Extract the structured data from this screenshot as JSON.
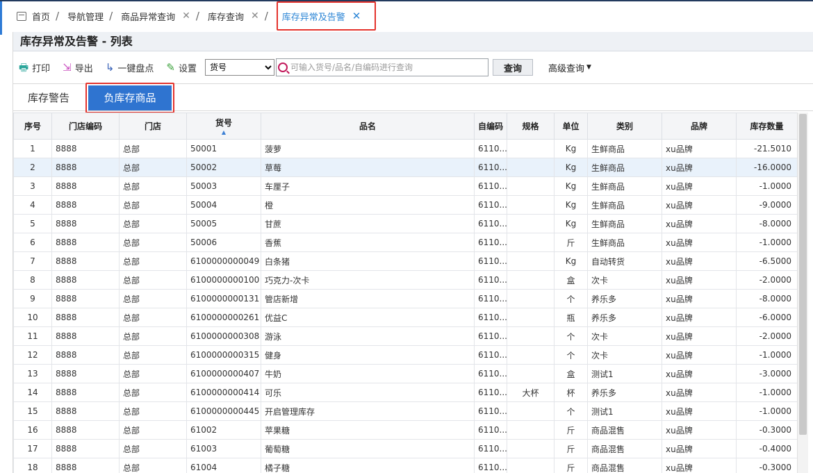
{
  "breadcrumbs": [
    {
      "label": "首页",
      "closable": false,
      "sep": "/"
    },
    {
      "label": "导航管理",
      "closable": false,
      "sep": "/"
    },
    {
      "label": "商品异常查询",
      "closable": true,
      "sep": "/"
    },
    {
      "label": "库存查询",
      "closable": true,
      "sep": "/"
    },
    {
      "label": "库存异常及告警",
      "closable": true,
      "active": true
    }
  ],
  "page_title": "库存异常及告警 - 列表",
  "toolbar": {
    "print_label": "打印",
    "export_label": "导出",
    "stocktake_label": "一键盘点",
    "settings_label": "设置",
    "type_select_value": "货号",
    "search_placeholder": "可输入货号/品名/自编码进行查询",
    "query_label": "查询",
    "advanced_query_label": "高级查询"
  },
  "subtabs": {
    "warning_label": "库存警告",
    "negative_label": "负库存商品"
  },
  "colors": {
    "accent_blue": "#2f74d0",
    "highlight_red": "#e4322c",
    "active_crumb": "#2d86d6"
  },
  "table": {
    "headers": [
      "序号",
      "门店编码",
      "门店",
      "货号",
      "品名",
      "自编码",
      "规格",
      "单位",
      "类别",
      "品牌",
      "库存数量"
    ],
    "rows": [
      [
        "1",
        "8888",
        "总部",
        "50001",
        "菠萝",
        "6110...",
        "",
        "Kg",
        "生鲜商品",
        "xu品牌",
        "-21.5010"
      ],
      [
        "2",
        "8888",
        "总部",
        "50002",
        "草莓",
        "6110...",
        "",
        "Kg",
        "生鲜商品",
        "xu品牌",
        "-16.0000"
      ],
      [
        "3",
        "8888",
        "总部",
        "50003",
        "车厘子",
        "6110...",
        "",
        "Kg",
        "生鲜商品",
        "xu品牌",
        "-1.0000"
      ],
      [
        "4",
        "8888",
        "总部",
        "50004",
        "橙",
        "6110...",
        "",
        "Kg",
        "生鲜商品",
        "xu品牌",
        "-9.0000"
      ],
      [
        "5",
        "8888",
        "总部",
        "50005",
        "甘蔗",
        "6110...",
        "",
        "Kg",
        "生鲜商品",
        "xu品牌",
        "-8.0000"
      ],
      [
        "6",
        "8888",
        "总部",
        "50006",
        "香蕉",
        "6110...",
        "",
        "斤",
        "生鲜商品",
        "xu品牌",
        "-1.0000"
      ],
      [
        "7",
        "8888",
        "总部",
        "6100000000049",
        "白条猪",
        "6110...",
        "",
        "Kg",
        "自动转货",
        "xu品牌",
        "-6.5000"
      ],
      [
        "8",
        "8888",
        "总部",
        "6100000000100",
        "巧克力-次卡",
        "6110...",
        "",
        "盒",
        "次卡",
        "xu品牌",
        "-2.0000"
      ],
      [
        "9",
        "8888",
        "总部",
        "6100000000131",
        "管店新增",
        "6110...",
        "",
        "个",
        "养乐多",
        "xu品牌",
        "-8.0000"
      ],
      [
        "10",
        "8888",
        "总部",
        "6100000000261",
        "优益C",
        "6110...",
        "",
        "瓶",
        "养乐多",
        "xu品牌",
        "-6.0000"
      ],
      [
        "11",
        "8888",
        "总部",
        "6100000000308",
        "游泳",
        "6110...",
        "",
        "个",
        "次卡",
        "xu品牌",
        "-2.0000"
      ],
      [
        "12",
        "8888",
        "总部",
        "6100000000315",
        "健身",
        "6110...",
        "",
        "个",
        "次卡",
        "xu品牌",
        "-1.0000"
      ],
      [
        "13",
        "8888",
        "总部",
        "6100000000407",
        "牛奶",
        "6110...",
        "",
        "盒",
        "测试1",
        "xu品牌",
        "-3.0000"
      ],
      [
        "14",
        "8888",
        "总部",
        "6100000000414",
        "可乐",
        "6110...",
        "大杯",
        "杯",
        "养乐多",
        "xu品牌",
        "-1.0000"
      ],
      [
        "15",
        "8888",
        "总部",
        "6100000000445",
        "开启管理库存",
        "6110...",
        "",
        "个",
        "测试1",
        "xu品牌",
        "-1.0000"
      ],
      [
        "16",
        "8888",
        "总部",
        "61002",
        "苹果糖",
        "6110...",
        "",
        "斤",
        "商品混售",
        "xu品牌",
        "-0.3000"
      ],
      [
        "17",
        "8888",
        "总部",
        "61003",
        "葡萄糖",
        "6110...",
        "",
        "斤",
        "商品混售",
        "xu品牌",
        "-0.4000"
      ],
      [
        "18",
        "8888",
        "总部",
        "61004",
        "橘子糖",
        "6110...",
        "",
        "斤",
        "商品混售",
        "xu品牌",
        "-0.3000"
      ]
    ]
  }
}
